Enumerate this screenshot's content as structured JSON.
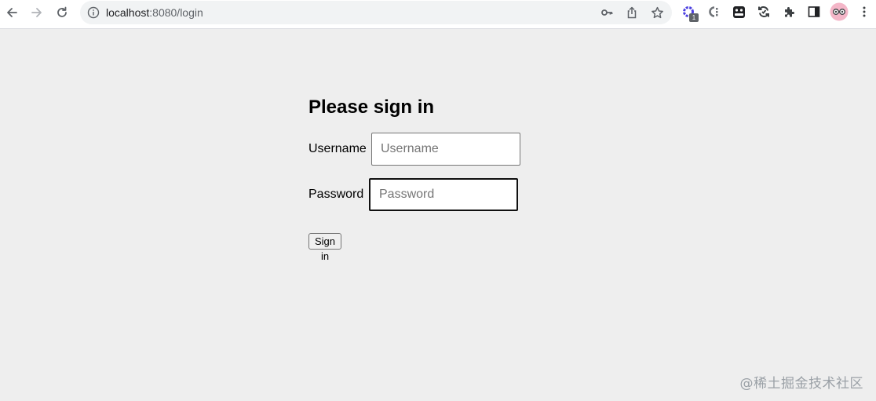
{
  "browser": {
    "url_host": "localhost",
    "url_rest": ":8080/login",
    "badge_count": "1"
  },
  "login": {
    "title": "Please sign in",
    "username_label": "Username",
    "username_placeholder": "Username",
    "username_value": "",
    "password_label": "Password",
    "password_placeholder": "Password",
    "password_value": "",
    "submit_label": "Sign in"
  },
  "watermark": "@稀土掘金技术社区",
  "colors": {
    "page_background": "#eeeeee",
    "toolbar_background": "#ffffff",
    "omnibox_background": "#f1f3f4",
    "extension_purple": "#4b3fe0",
    "profile_avatar": "#f4b6c8"
  },
  "icons": {
    "back": "arrow-left-icon",
    "forward": "arrow-right-icon",
    "reload": "reload-icon",
    "site_info": "info-circle-icon",
    "passwords": "key-icon",
    "share": "share-icon",
    "bookmark": "star-icon",
    "extensions": [
      "gear-extension-icon",
      "c-extension-icon",
      "tampermonkey-extension-icon",
      "sync-extension-icon",
      "puzzle-icon"
    ],
    "side_panel": "side-panel-icon",
    "profile": "avatar-icon",
    "menu": "more-vert-icon"
  }
}
